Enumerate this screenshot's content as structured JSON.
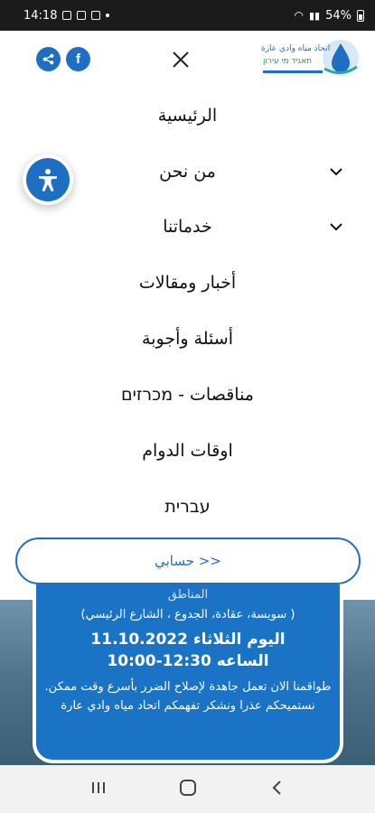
{
  "status_bar": {
    "time": "14:18",
    "battery": "54%"
  },
  "menu": {
    "items": [
      {
        "label": "الرئيسية",
        "has_submenu": false
      },
      {
        "label": "من نحن",
        "has_submenu": true
      },
      {
        "label": "خدماتنا",
        "has_submenu": true
      },
      {
        "label": "أخبار ومقالات",
        "has_submenu": false
      },
      {
        "label": "أسئلة وأجوبة",
        "has_submenu": false
      },
      {
        "label": "مناقصات - מכרזים",
        "has_submenu": false
      },
      {
        "label": "اوقات الدوام",
        "has_submenu": false
      },
      {
        "label": "עברית",
        "has_submenu": false
      }
    ]
  },
  "account": {
    "label": "حسابي >>"
  },
  "notice": {
    "line0": "المناطق",
    "line1": "(سويسة، عقادة، الجدوع ، الشارع الرئيسي )",
    "line2": "اليوم الثلاثاء 11.10.2022",
    "line3": "الساعه 12:30-10:00",
    "line4": "طواقمنا الان تعمل جاهدة لإصلاح الضرر بأسرع وقت ممكن. نستميحكم عذرا ونشكر تفهمكم اتحاد مياه وادي عارة"
  },
  "logo": {
    "text_ar": "اتحاد مياه وادي عارة",
    "text_he": "תאגיד מי עירון"
  },
  "colors": {
    "brand_blue": "#1e6fc4",
    "card_blue": "#1a73c4"
  },
  "icons": {
    "close": "close-icon",
    "facebook": "facebook-icon",
    "accessibility": "accessibility-icon"
  }
}
